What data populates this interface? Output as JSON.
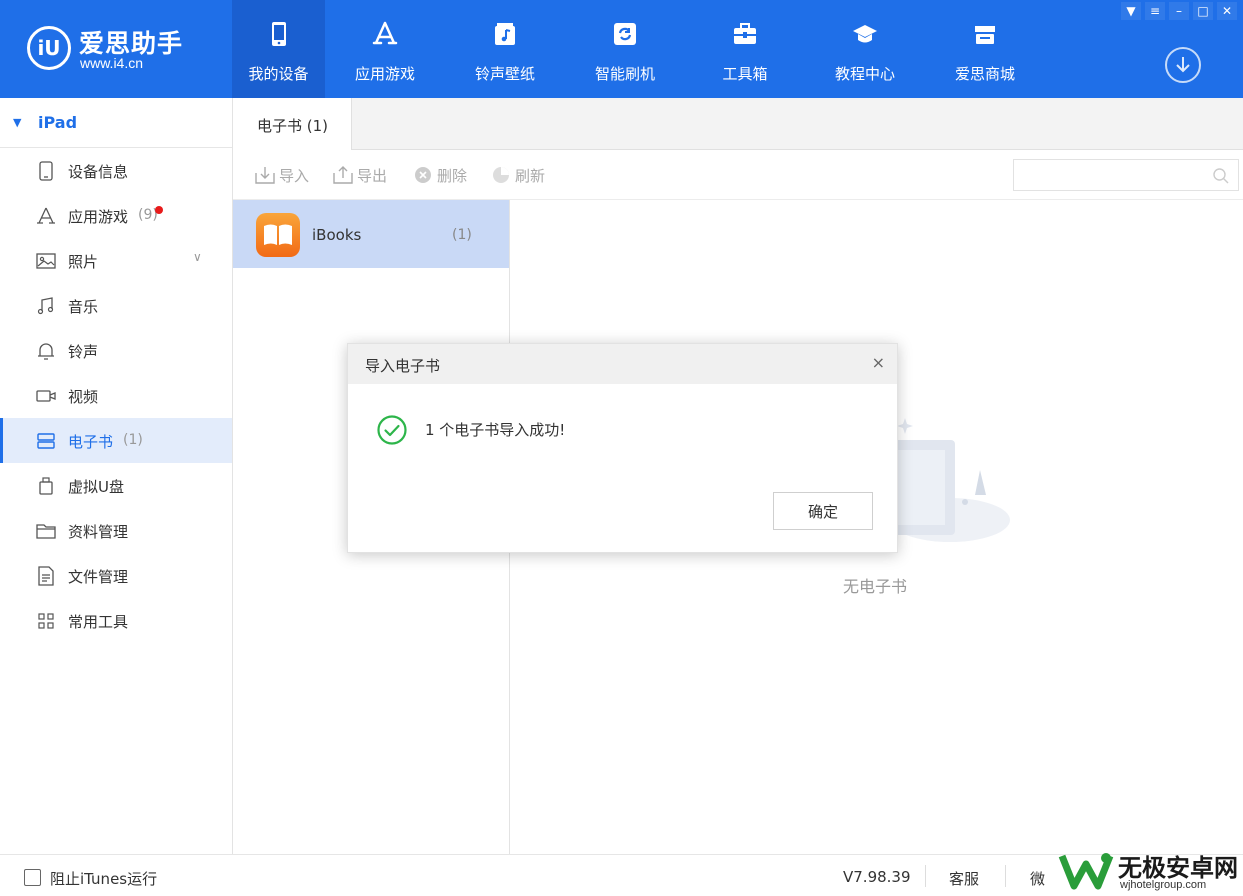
{
  "app": {
    "logo_text": "爱思助手",
    "logo_url": "www.i4.cn",
    "logo_mark": "iU",
    "brand_color": "#1f6fe8"
  },
  "nav": [
    {
      "label": "我的设备",
      "icon": "phone-icon",
      "active": true
    },
    {
      "label": "应用游戏",
      "icon": "app-store-icon",
      "active": false
    },
    {
      "label": "铃声壁纸",
      "icon": "music-note-icon",
      "active": false
    },
    {
      "label": "智能刷机",
      "icon": "refresh-icon",
      "active": false
    },
    {
      "label": "工具箱",
      "icon": "toolbox-icon",
      "active": false
    },
    {
      "label": "教程中心",
      "icon": "graduation-cap-icon",
      "active": false
    },
    {
      "label": "爱思商城",
      "icon": "store-icon",
      "active": false
    }
  ],
  "window_controls": [
    "shirt-icon",
    "menu-icon",
    "minimize-icon",
    "maximize-icon",
    "close-icon"
  ],
  "sidebar": {
    "device": "iPad",
    "items": [
      {
        "label": "设备信息",
        "icon": "device-info-icon"
      },
      {
        "label": "应用游戏",
        "count": "(9)",
        "icon": "app-store-icon",
        "badge": true
      },
      {
        "label": "照片",
        "icon": "photo-icon",
        "expandable": true
      },
      {
        "label": "音乐",
        "icon": "music-icon"
      },
      {
        "label": "铃声",
        "icon": "bell-icon"
      },
      {
        "label": "视频",
        "icon": "video-icon"
      },
      {
        "label": "电子书",
        "count": "(1)",
        "icon": "ebook-icon",
        "active": true
      },
      {
        "label": "虚拟U盘",
        "icon": "usb-drive-icon"
      },
      {
        "label": "资料管理",
        "icon": "folder-icon"
      },
      {
        "label": "文件管理",
        "icon": "file-icon"
      },
      {
        "label": "常用工具",
        "icon": "grid-icon"
      }
    ]
  },
  "main": {
    "tab_label": "电子书 (1)",
    "toolbar": {
      "import": "导入",
      "export": "导出",
      "delete": "删除",
      "refresh": "刷新"
    },
    "search_placeholder": "",
    "list": [
      {
        "name": "iBooks",
        "count": "(1)"
      }
    ],
    "empty_text": "无电子书"
  },
  "modal": {
    "title": "导入电子书",
    "message": "1 个电子书导入成功!",
    "confirm": "确定",
    "close": "×"
  },
  "statusbar": {
    "checkbox_label": "阻止iTunes运行",
    "checked": false,
    "version": "V7.98.39",
    "service": "客服",
    "wechat": "微"
  },
  "watermark": {
    "name": "无极安卓网",
    "url": "wjhotelgroup.com"
  }
}
